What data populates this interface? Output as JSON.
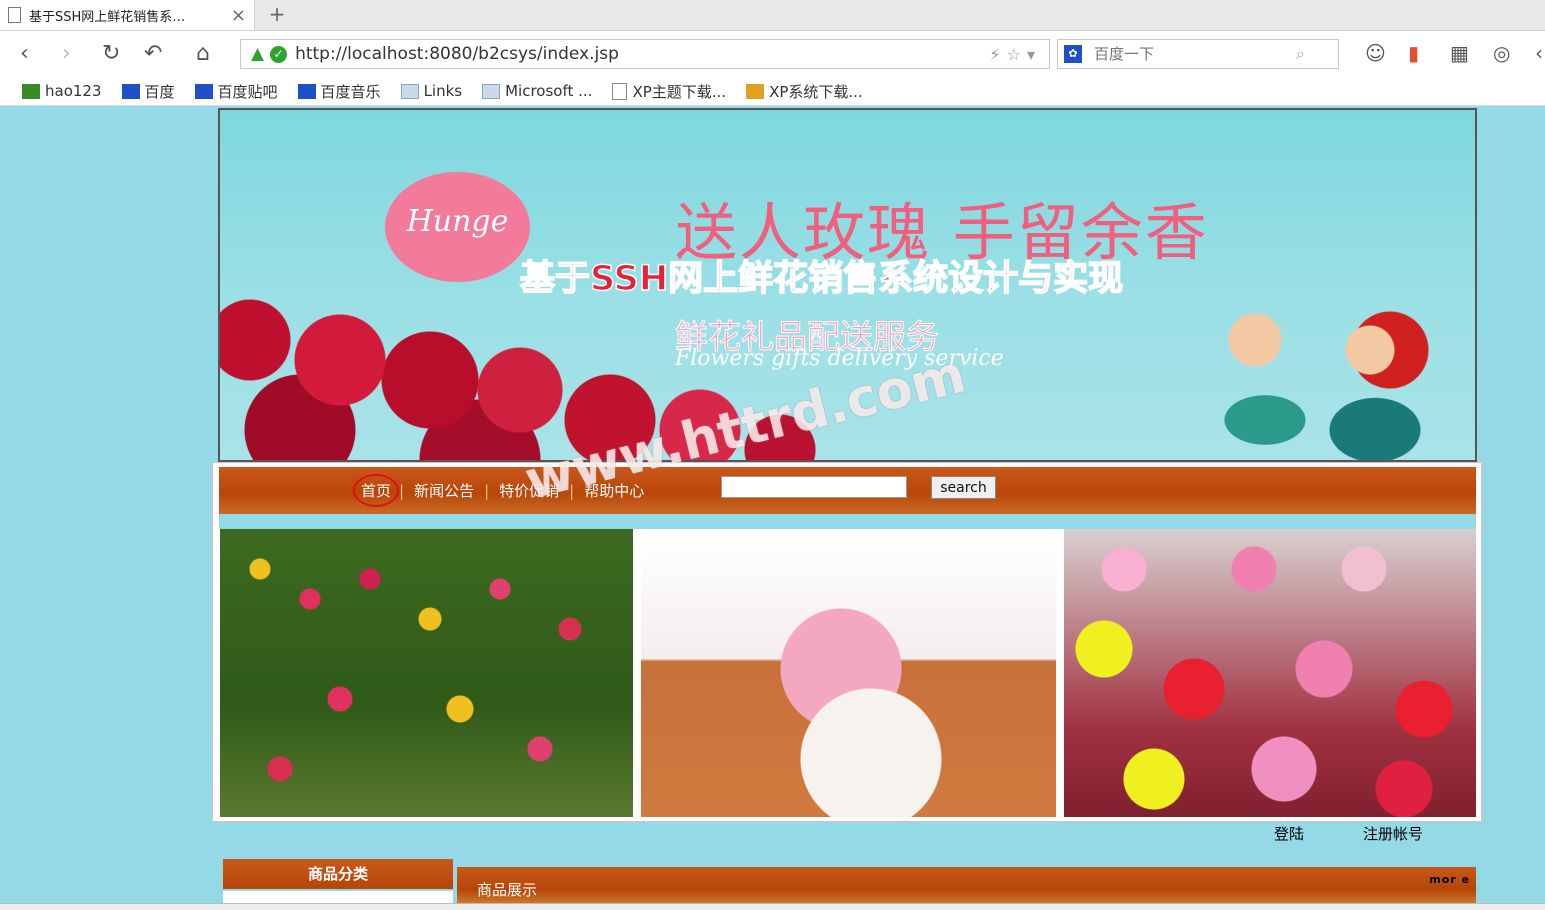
{
  "tab": {
    "title": "基于SSH网上鲜花销售系…",
    "close": "×",
    "new": "+"
  },
  "nav": {
    "back": "‹",
    "forward": "›",
    "reload": "↻",
    "undo": "↶",
    "home": "⌂"
  },
  "address": {
    "url": "http://localhost:8080/b2csys/index.jsp",
    "tools": "⚡☆▾"
  },
  "search": {
    "placeholder": "百度一下",
    "engine_icon": "paw-icon"
  },
  "bookmarks": [
    {
      "label": "hao123",
      "icon": "hao"
    },
    {
      "label": "百度",
      "icon": "paw"
    },
    {
      "label": "百度贴吧",
      "icon": "paw"
    },
    {
      "label": "百度音乐",
      "icon": "paw"
    },
    {
      "label": "Links",
      "icon": "folder"
    },
    {
      "label": "Microsoft ...",
      "icon": "folder"
    },
    {
      "label": "XP主题下载...",
      "icon": "doc"
    },
    {
      "label": "XP系统下载...",
      "icon": "xp"
    }
  ],
  "banner": {
    "logo": "Hunge",
    "slogan": "送人玫瑰 手留余香",
    "title": "基于SSH网上鲜花销售系统设计与实现",
    "subtitle": "鲜花礼品配送服务",
    "subtitle_en": "Flowers gifts delivery service"
  },
  "watermark": "www.httrd.com",
  "site_nav": {
    "links": [
      "首页",
      "新闻公告",
      "特价促销",
      "帮助中心"
    ],
    "search_button": "search"
  },
  "user": {
    "login": "登陆",
    "register": "注册帐号"
  },
  "sections": {
    "category": "商品分类",
    "products": "商品展示",
    "more": "mor e"
  },
  "colors": {
    "page_bg": "#94d9e6",
    "nav_bar": "#b94608",
    "accent": "#c9581b"
  }
}
